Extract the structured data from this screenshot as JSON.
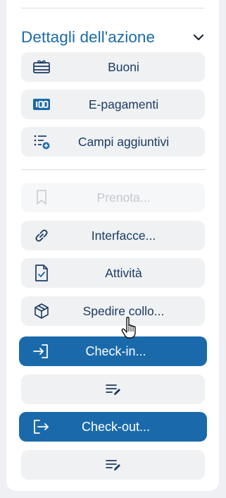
{
  "section": {
    "title": "Dettagli dell'azione"
  },
  "actions": {
    "vouchers": {
      "label": "Buoni",
      "icon": "gift-card-icon"
    },
    "epayments": {
      "label": "E-pagamenti",
      "icon": "payment-card-icon"
    },
    "custom_fields": {
      "label": "Campi aggiuntivi",
      "icon": "list-add-icon"
    },
    "book": {
      "label": "Prenota...",
      "icon": "bookmark-icon",
      "disabled": true
    },
    "interfaces": {
      "label": "Interfacce...",
      "icon": "link-icon"
    },
    "tasks": {
      "label": "Attività",
      "icon": "task-check-icon"
    },
    "ship": {
      "label": "Spedire collo...",
      "icon": "package-icon"
    },
    "checkin": {
      "label": "Check-in...",
      "icon": "login-arrow-icon"
    },
    "checkin_notes": {
      "icon": "edit-notes-icon"
    },
    "checkout": {
      "label": "Check-out...",
      "icon": "logout-arrow-icon"
    },
    "checkout_notes": {
      "icon": "edit-notes-icon"
    }
  },
  "colors": {
    "accent": "#1a6aab",
    "button_bg": "#eff1f3",
    "text": "#1d3b63",
    "disabled_text": "#c3c9d1"
  }
}
